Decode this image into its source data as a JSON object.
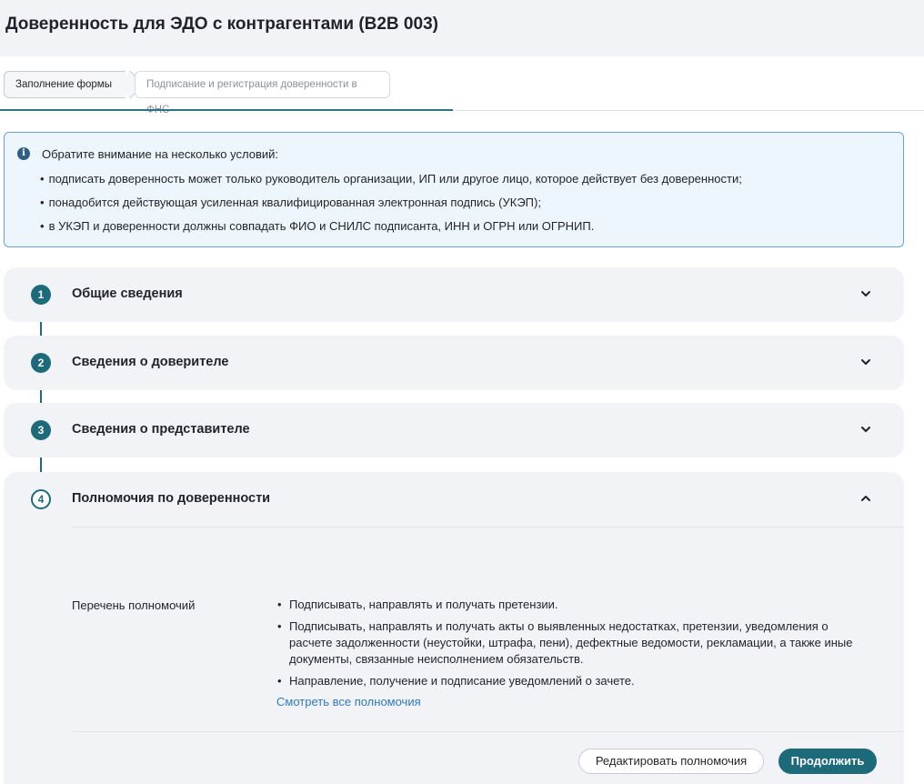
{
  "page": {
    "title": "Доверенность для ЭДО с контрагентами (B2B 003)"
  },
  "stepper": {
    "active": "Заполнение формы",
    "next": "Подписание и регистрация доверенности в ФНС"
  },
  "notice": {
    "icon": "info-icon",
    "icon_glyph": "i",
    "title": "Обратите внимание на несколько условий:",
    "items": [
      "подписать доверенность может только руководитель организации, ИП или другое лицо, которое действует без доверенности;",
      "понадобится действующая усиленная квалифицированная электронная подпись (УКЭП);",
      "в УКЭП и доверенности должны совпадать ФИО и СНИЛС подписанта, ИНН и ОГРН или ОГРНИП."
    ]
  },
  "sections": [
    {
      "number": "1",
      "title": "Общие сведения",
      "expanded": false
    },
    {
      "number": "2",
      "title": "Сведения о доверителе",
      "expanded": false
    },
    {
      "number": "3",
      "title": "Сведения о представителе",
      "expanded": false
    },
    {
      "number": "4",
      "title": "Полномочия по доверенности",
      "expanded": true
    }
  ],
  "powers": {
    "label": "Перечень полномочий",
    "items": [
      "Подписывать, направлять и получать претензии.",
      "Подписывать, направлять и получать акты о выявленных недостатках, претензии, уведомления о расчете задолженности (неустойки, штрафа, пени), дефектные ведомости, рекламации, а также иные документы, связанные неисполнением обязательств.",
      "Направление, получение и подписание уведомлений о зачете."
    ],
    "see_all": "Смотреть все полномочия"
  },
  "actions": {
    "edit": "Редактировать полномочия",
    "continue": "Продолжить"
  },
  "colors": {
    "accent": "#1d6a7a",
    "link": "#2f7abf",
    "notice_border": "#6fa1d6",
    "notice_bg": "#eef6fd"
  }
}
